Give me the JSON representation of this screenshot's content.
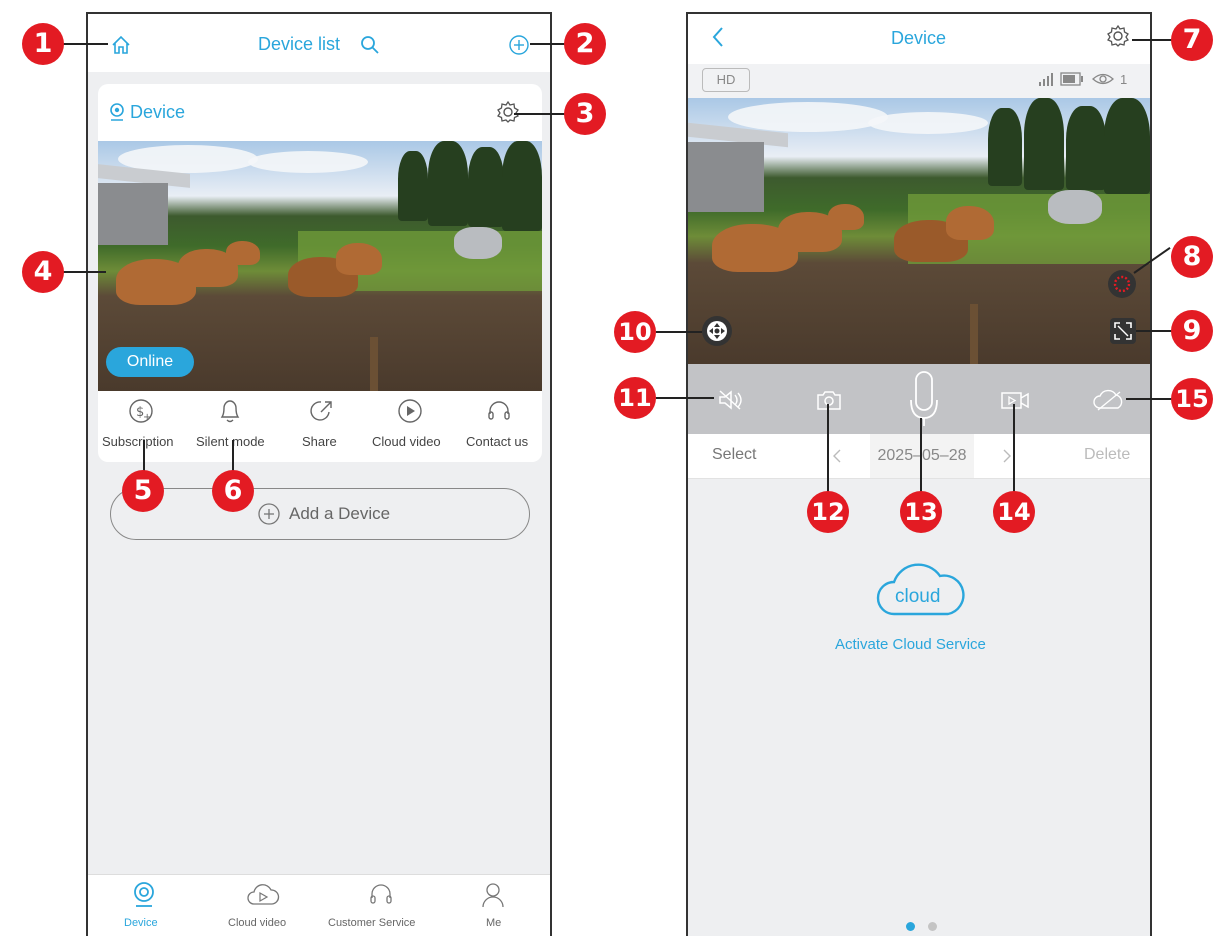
{
  "left": {
    "header": {
      "title": "Device list"
    },
    "card": {
      "device_name": "Device",
      "status": "Online",
      "actions": [
        {
          "label": "Subscription",
          "icon": "subscription-icon"
        },
        {
          "label": "Silent mode",
          "icon": "bell-icon"
        },
        {
          "label": "Share",
          "icon": "share-icon"
        },
        {
          "label": "Cloud video",
          "icon": "play-icon"
        },
        {
          "label": "Contact us",
          "icon": "headset-icon"
        }
      ]
    },
    "add_device": "Add a Device",
    "tabs": [
      {
        "label": "Device",
        "icon": "camera-icon",
        "active": true
      },
      {
        "label": "Cloud video",
        "icon": "cloud-play-icon",
        "active": false
      },
      {
        "label": "Customer Service",
        "icon": "headset-icon",
        "active": false
      },
      {
        "label": "Me",
        "icon": "person-icon",
        "active": false
      }
    ]
  },
  "right": {
    "header": {
      "title": "Device"
    },
    "quality": "HD",
    "viewer_count": "1",
    "date_bar": {
      "select": "Select",
      "date": "2025–05–28",
      "delete": "Delete"
    },
    "cloud_word": "cloud",
    "activate_label": "Activate Cloud Service"
  },
  "callouts": [
    "1",
    "2",
    "3",
    "4",
    "5",
    "6",
    "7",
    "8",
    "9",
    "10",
    "11",
    "12",
    "13",
    "14",
    "15"
  ],
  "colors": {
    "accent": "#2aa6dc",
    "callout": "#e31b23",
    "background": "#eeeff1"
  }
}
